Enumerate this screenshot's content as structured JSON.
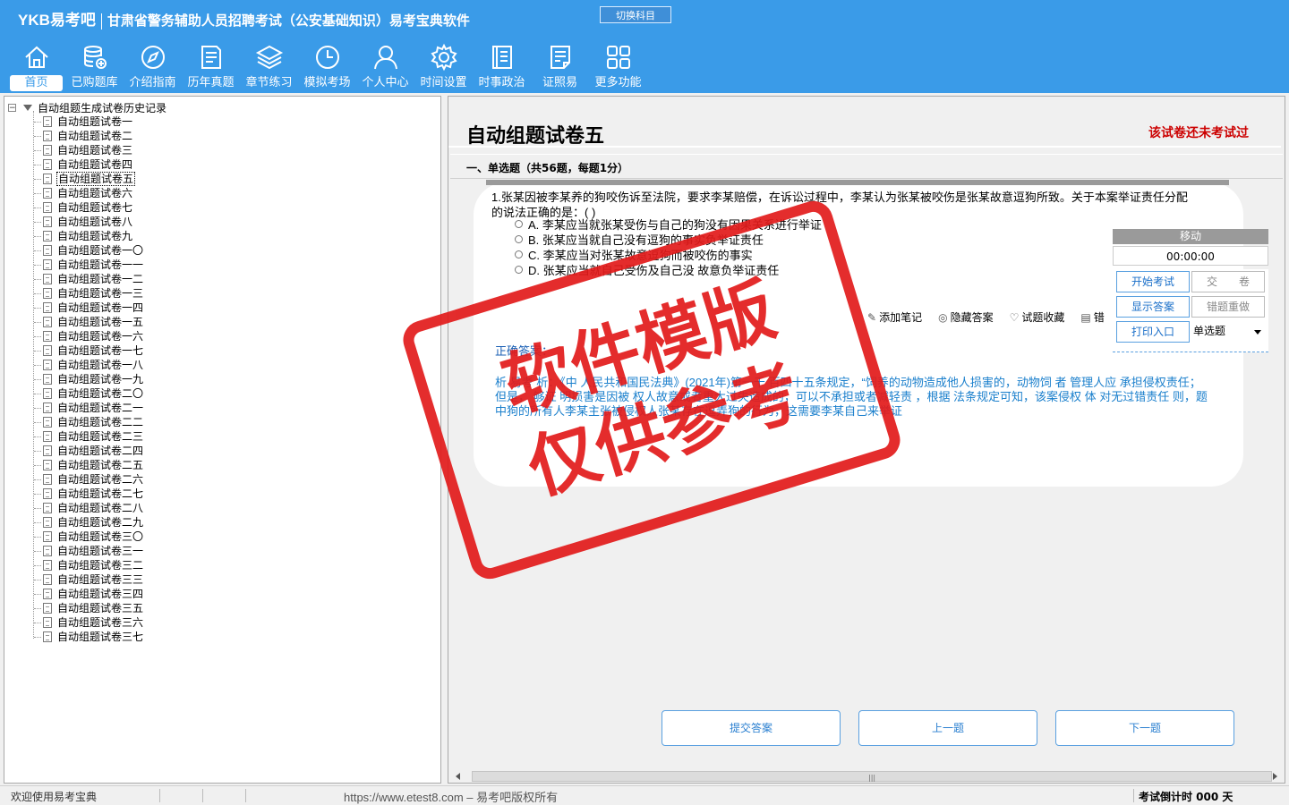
{
  "header": {
    "logo": "YKB易考吧",
    "app_title": "甘肃省警务辅助人员招聘考试（公安基础知识）易考宝典软件",
    "switch_subject": "切换科目"
  },
  "nav": [
    {
      "label": "首页",
      "icon": "home-icon"
    },
    {
      "label": "已购题库",
      "icon": "database-icon"
    },
    {
      "label": "介绍指南",
      "icon": "compass-icon"
    },
    {
      "label": "历年真题",
      "icon": "document-list-icon"
    },
    {
      "label": "章节练习",
      "icon": "layers-icon"
    },
    {
      "label": "模拟考场",
      "icon": "clock-icon"
    },
    {
      "label": "个人中心",
      "icon": "user-icon"
    },
    {
      "label": "时间设置",
      "icon": "gear-icon"
    },
    {
      "label": "时事政治",
      "icon": "notebook-icon"
    },
    {
      "label": "证照易",
      "icon": "certificate-icon"
    },
    {
      "label": "更多功能",
      "icon": "grid-icon"
    }
  ],
  "tree": {
    "root": "自动组题生成试卷历史记录",
    "selected_index": 4,
    "items": [
      "自动组题试卷一",
      "自动组题试卷二",
      "自动组题试卷三",
      "自动组题试卷四",
      "自动组题试卷五",
      "自动组题试卷六",
      "自动组题试卷七",
      "自动组题试卷八",
      "自动组题试卷九",
      "自动组题试卷一〇",
      "自动组题试卷一一",
      "自动组题试卷一二",
      "自动组题试卷一三",
      "自动组题试卷一四",
      "自动组题试卷一五",
      "自动组题试卷一六",
      "自动组题试卷一七",
      "自动组题试卷一八",
      "自动组题试卷一九",
      "自动组题试卷二〇",
      "自动组题试卷二一",
      "自动组题试卷二二",
      "自动组题试卷二三",
      "自动组题试卷二四",
      "自动组题试卷二五",
      "自动组题试卷二六",
      "自动组题试卷二七",
      "自动组题试卷二八",
      "自动组题试卷二九",
      "自动组题试卷三〇",
      "自动组题试卷三一",
      "自动组题试卷三二",
      "自动组题试卷三三",
      "自动组题试卷三四",
      "自动组题试卷三五",
      "自动组题试卷三六",
      "自动组题试卷三七"
    ]
  },
  "paper": {
    "title": "自动组题试卷五",
    "status": "该试卷还未考试过",
    "section": "一、单选题（共56题，每题1分）"
  },
  "question": {
    "text": "1.张某因被李某养的狗咬伤诉至法院，要求李某赔偿，在诉讼过程中，李某认为张某被咬伤是张某故意逗狗所致。关于本案举证责任分配的说法正确的是：( )",
    "options": [
      "A. 李某应当就张某受伤与自己的狗没有因果关系进行举证",
      "B. 张某应当就自己没有逗狗的事实负举证责任",
      "C. 李某应当对张某故意逗狗而被咬伤的事实",
      "D. 张某应当就自己受伤及自己没        故意负举证责任"
    ],
    "tools": {
      "note": "添加笔记",
      "hide": "隐藏答案",
      "favorite": "试题收藏",
      "more": "错"
    },
    "answer_label": "正确答案：",
    "explanation": "  析   易考   析：《中   人民共和国民法典》(2021年)第一千   百四十五条规定，“饲养的动物造成他人损害的，动物饲   者   管理人应   承担侵权责任；但是，   够证   明损害是因被   权人故意或者重大过失造成的，可以不承担或者减轻责   ，根据   法条规定可知，该案侵权   体   对无过错责任   则，题中狗的所有人李某主张被侵权人张某存在逗弄狗的行为，这需要李某自己来举证"
  },
  "control": {
    "move": "移动",
    "timer": "00:00:00",
    "start": "开始考试",
    "submit_paper": "交　　卷",
    "show_answer": "显示答案",
    "redo_wrong": "错题重做",
    "print": "打印入口",
    "type_select": "单选题"
  },
  "buttons": {
    "submit": "提交答案",
    "prev": "上一题",
    "next": "下一题"
  },
  "watermark": {
    "line1": "软件模版",
    "line2": "仅供参考"
  },
  "status": {
    "welcome": "欢迎使用易考宝典",
    "copyright": "https://www.etest8.com – 易考吧版权所有",
    "countdown": "考试倒计时 000 天"
  }
}
